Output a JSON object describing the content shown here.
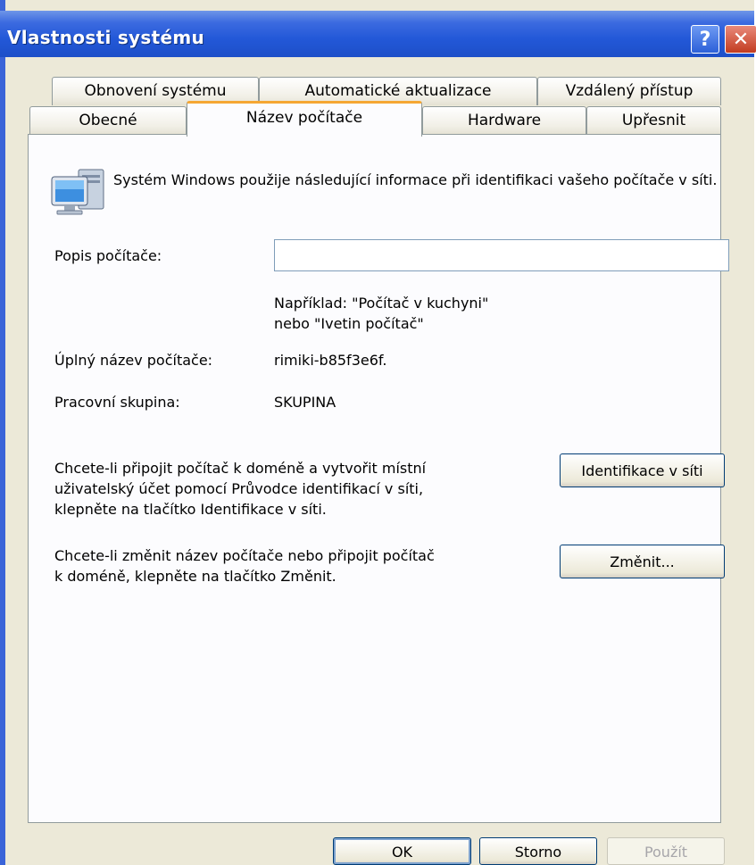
{
  "window": {
    "title": "Vlastnosti systému",
    "help": "?",
    "close": "✕"
  },
  "tabs_back": [
    "Obnovení systému",
    "Automatické aktualizace",
    "Vzdálený přístup"
  ],
  "tabs_front": [
    "Obecné",
    "Název počítače",
    "Hardware",
    "Upřesnit"
  ],
  "active_tab": "Název počítače",
  "intro": "Systém Windows použije následující informace při identifikaci vašeho počítače v síti.",
  "description": {
    "label": "Popis počítače:",
    "value": "",
    "example_line1": "Například: \"Počítač v kuchyni\"",
    "example_line2": "nebo \"Ivetin počítač\""
  },
  "full_name": {
    "label": "Úplný název počítače:",
    "value": "rimiki-b85f3e6f."
  },
  "workgroup": {
    "label": "Pracovní skupina:",
    "value": "SKUPINA"
  },
  "network_id": {
    "text_line1": "Chcete-li připojit počítač k doméně a vytvořit místní",
    "text_line2": "uživatelský účet pomocí Průvodce identifikací v síti,",
    "text_line3": "klepněte na tlačítko Identifikace v síti.",
    "button": "Identifikace v síti"
  },
  "change": {
    "text_line1": "Chcete-li změnit název počítače nebo připojit počítač",
    "text_line2": "k doméně, klepněte na tlačítko Změnit.",
    "button": "Změnit..."
  },
  "footer": {
    "ok": "OK",
    "cancel": "Storno",
    "apply": "Použít"
  }
}
